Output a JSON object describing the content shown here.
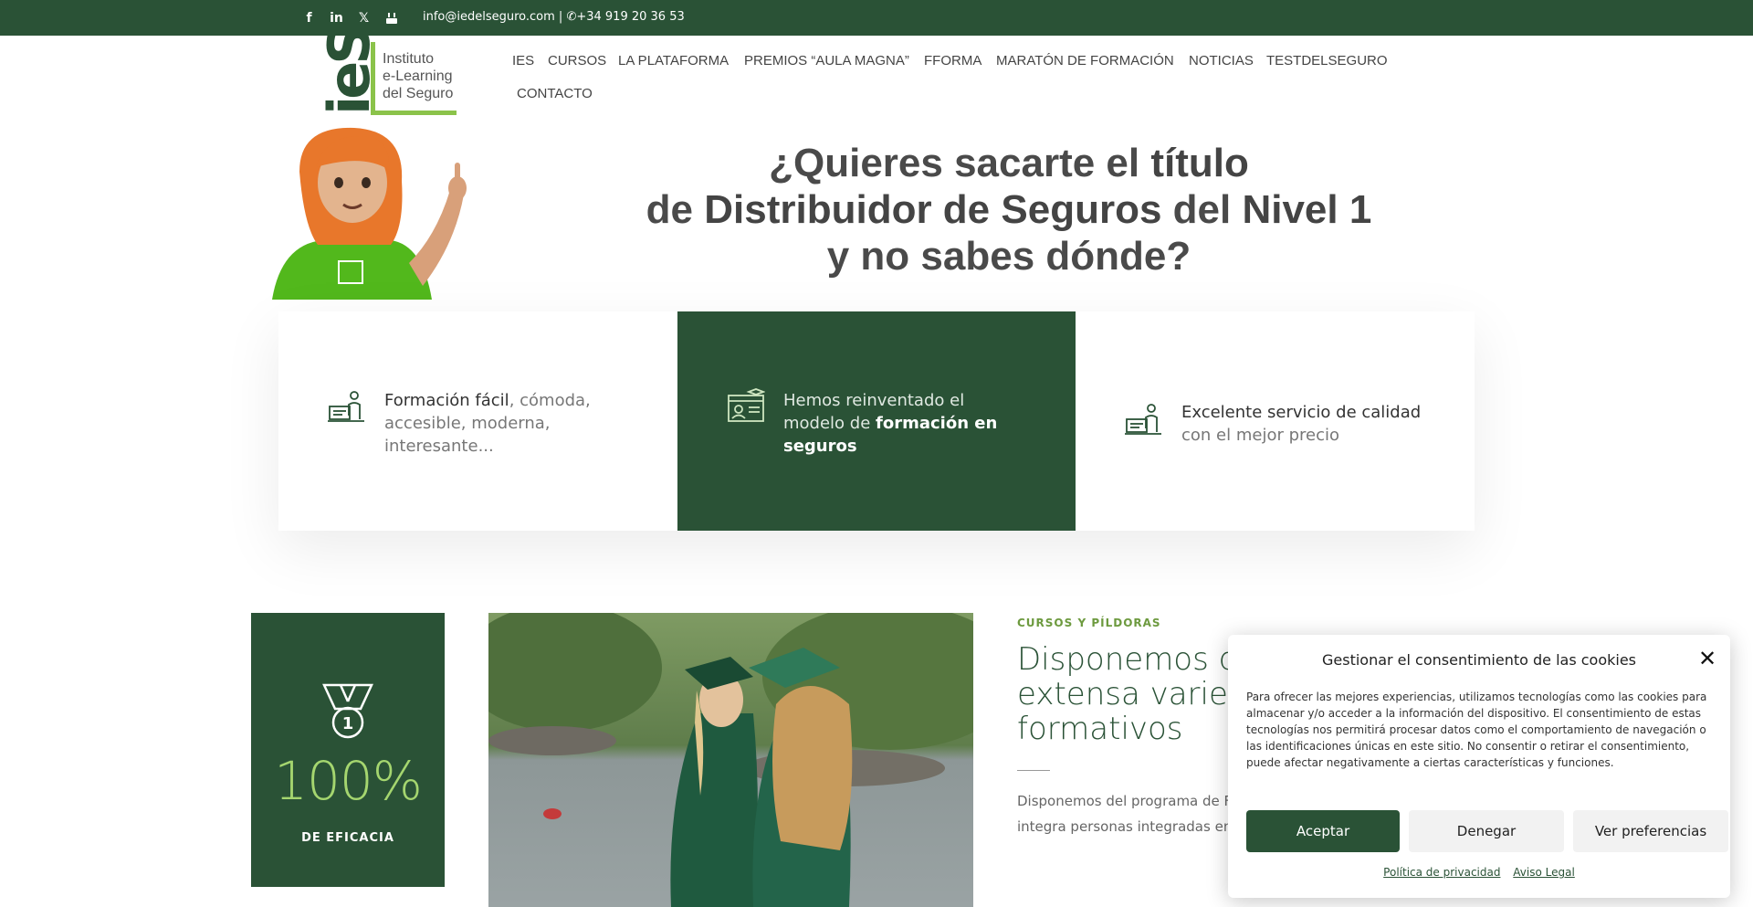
{
  "topbar": {
    "social_icons": [
      "facebook-icon",
      "linkedin-icon",
      "x-icon",
      "youtube-icon"
    ],
    "contact": "info@iedelseguro.com | ✆+34 919 20 36 53"
  },
  "logo": {
    "letters": "ieS",
    "line1": "Instituto",
    "line2": "e-Learning",
    "line3": "del Seguro"
  },
  "nav": {
    "items": [
      "IES",
      "CURSOS",
      "LA PLATAFORMA",
      "PREMIOS “AULA MAGNA”",
      "FFORMA",
      "MARATÓN DE FORMACIÓN",
      "NOTICIAS",
      "TESTDELSEGURO",
      "CONTACTO"
    ]
  },
  "hero": {
    "l1a": "¿Quieres sacarte el ",
    "l1b": "título",
    "l2a": "de ",
    "l2b": "Distribuidor de Seguros",
    "l2c": " del ",
    "l2d": "Nivel 1",
    "l3": "y no sabes dónde?"
  },
  "features": [
    {
      "icon": "desk-study-icon",
      "strong": "Formación fácil",
      "rest": ", cómoda, accesible, moderna, interesante..."
    },
    {
      "icon": "online-class-icon",
      "pre": "Hemos reinventado el modelo de ",
      "strong": "formación en seguros"
    },
    {
      "icon": "desk-study-icon",
      "strong": "Excelente servicio de calidad",
      "rest": " con el mejor precio"
    }
  ],
  "stat": {
    "icon": "medal-icon",
    "medal_number": "1",
    "value": "100%",
    "label": "DE EFICACIA"
  },
  "section": {
    "kicker": "CURSOS Y PÍLDORAS",
    "title": "Disponemos d extensa varied formativos",
    "body": "Disponemos del programa de F horas para las personas integra personas integradas en el NIVE"
  },
  "cookie": {
    "title": "Gestionar el consentimiento de las cookies",
    "body": "Para ofrecer las mejores experiencias, utilizamos tecnologías como las cookies para almacenar y/o acceder a la información del dispositivo. El consentimiento de estas tecnologías nos permitirá procesar datos como el comportamiento de navegación o las identificaciones únicas en este sitio. No consentir o retirar el consentimiento, puede afectar negativamente a ciertas características y funciones.",
    "accept": "Aceptar",
    "deny": "Denegar",
    "prefs": "Ver preferencias",
    "privacy": "Política de privacidad",
    "legal": "Aviso Legal"
  },
  "colors": {
    "brand_green": "#2a5236",
    "accent_green": "#8bc34a",
    "stat_green": "#a5d66f"
  }
}
